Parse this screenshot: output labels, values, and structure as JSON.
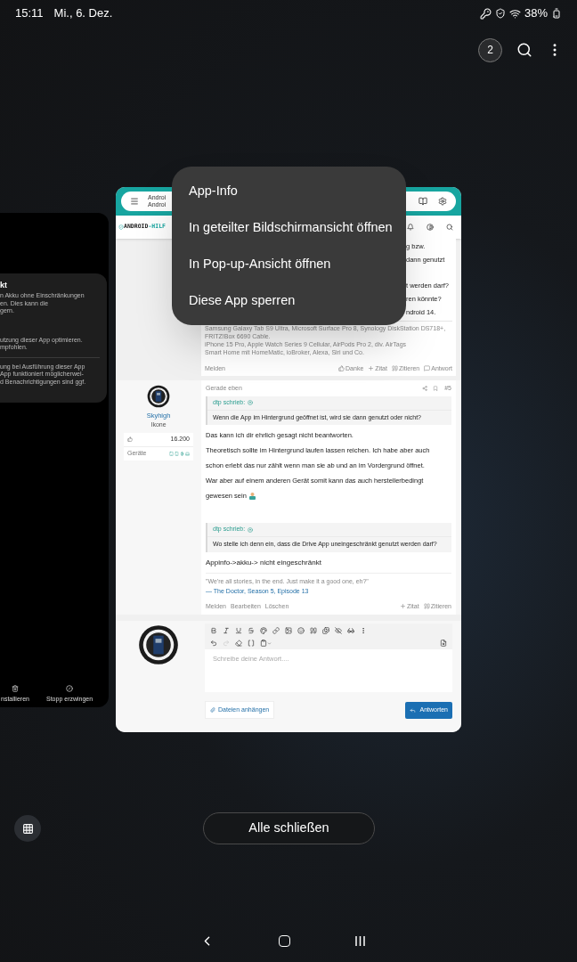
{
  "status_bar": {
    "time": "15:11",
    "date": "Mi., 6. Dez.",
    "battery": "38%"
  },
  "top_bar": {
    "window_count": "2"
  },
  "left_card": {
    "title": "kt",
    "paragraphs": [
      [
        "n Akku ohne Einschränkungen",
        "en. Dies kann die",
        "gern."
      ],
      [
        "utzung dieser App optimieren.",
        "mpfohlen."
      ],
      [
        "ung bei Ausführung dieser App",
        "App funktioniert möglicherwei-",
        "d Benachrichtigungen sind ggf."
      ]
    ],
    "actions": [
      {
        "kind": "uninstall",
        "label": "nstallieren"
      },
      {
        "kind": "stop",
        "label": "Stopp erzwingen"
      }
    ]
  },
  "browser_card": {
    "tab_title_lines": [
      "Androi",
      "Androi"
    ],
    "site_logo": [
      "ANDROID",
      "-HILF"
    ],
    "post_1": {
      "text_fragments": [
        [
          "g bzw.",
          "dann genutzt"
        ],
        [
          "t werden darf?",
          "ren könnte?",
          "ndroid 14."
        ]
      ],
      "signature": [
        "Samsung Galaxy Tab S9 Ultra, Microsoft Surface Pro 8, Synology DiskStation DS718+, FRITZ!Box 6690 Cable.",
        "iPhone 15 Pro, Apple Watch Series 9 Cellular, AirPods Pro 2, div. AirTags",
        "Smart Home mit HomeMatic, ioBroker, Alexa, Siri und Co."
      ],
      "left_actions": [
        "Melden"
      ],
      "right_actions": [
        {
          "kind": "like",
          "label": "Danke"
        },
        {
          "kind": "plus",
          "label": "Zitat"
        },
        {
          "kind": "quote",
          "label": "Zitieren"
        },
        {
          "kind": "reply",
          "label": "Antwort"
        }
      ]
    },
    "post_2": {
      "user": "Skyhigh",
      "rank": "Ikone",
      "likes": "16.200",
      "devices_label": "Geräte",
      "time": "Gerade eben",
      "number": "#5",
      "content": [
        {
          "kind": "quote",
          "author": "dtp schrieb:",
          "text": "Wenn die App im Hintergrund geöffnet ist, wird sie dann genutzt oder nicht?"
        },
        {
          "kind": "paragraph",
          "lines": [
            "Das kann ich dir ehrlich gesagt nicht beantworten.",
            "Theoretisch sollte im Hintergrund laufen lassen reichen. Ich habe aber auch schon erlebt das nur zählt wenn man sie ab und an im Vordergrund öffnet.",
            "War aber auf einem anderen Gerät somit kann das auch herstellerbedingt gewesen sein"
          ]
        },
        {
          "kind": "quote",
          "author": "dtp schrieb:",
          "text": "Wo stelle ich denn ein, dass die Drive App uneingeschränkt genutzt werden darf?"
        },
        {
          "kind": "reply",
          "text": "Appinfo->akku-> nicht eingeschränkt"
        }
      ],
      "signature_quote": "\"We're all stories, in the end. Just make it a good one, eh?\"",
      "signature_link": "— The Doctor, Season 5, Episode 13",
      "left_actions": [
        "Melden",
        "Bearbeiten",
        "Löschen"
      ],
      "right_actions": [
        {
          "kind": "plus",
          "label": "Zitat"
        },
        {
          "kind": "quote",
          "label": "Zitieren"
        }
      ]
    },
    "editor": {
      "placeholder": "Schreibe deine Antwort....",
      "attach": "Dateien anhängen",
      "submit": "Antworten"
    }
  },
  "context_menu": [
    "App-Info",
    "In geteilter Bildschirmansicht öffnen",
    "In Pop-up-Ansicht öffnen",
    "Diese App sperren"
  ],
  "close_all": "Alle schließen"
}
